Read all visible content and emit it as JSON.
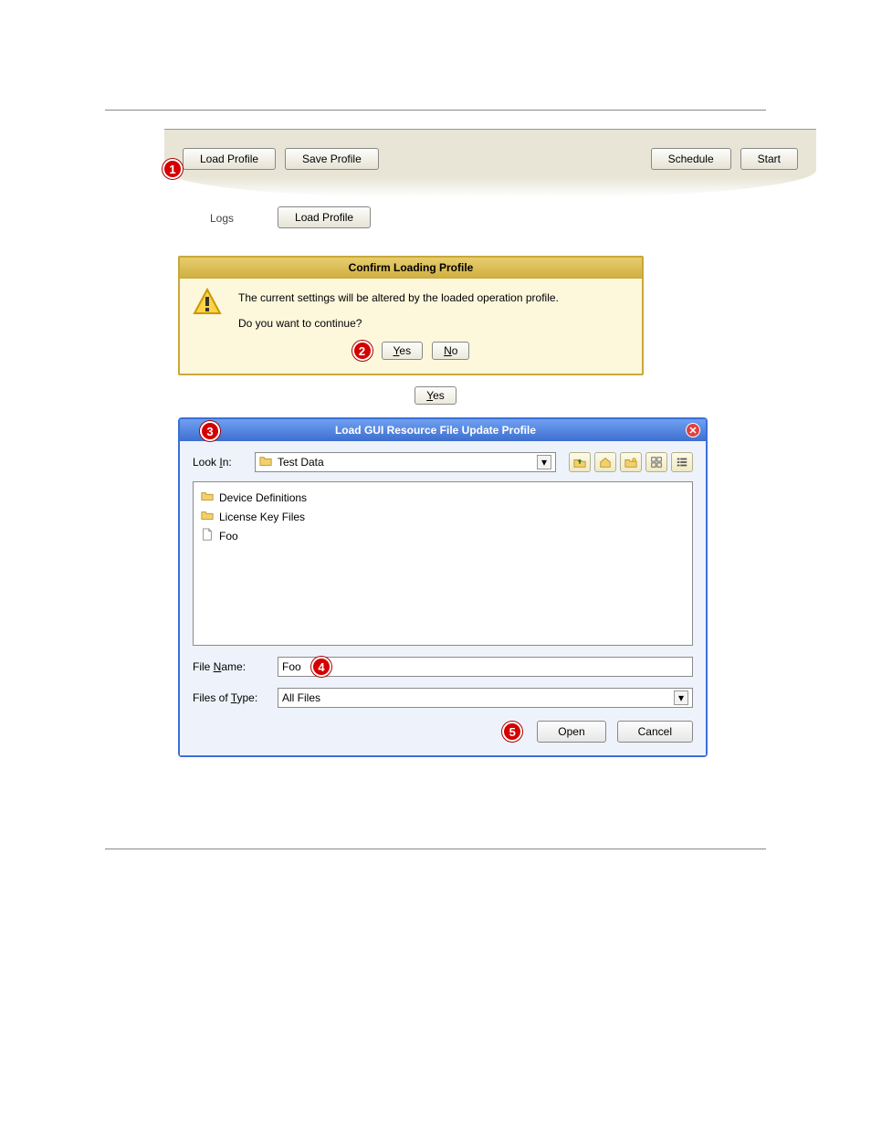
{
  "toolbar": {
    "load_profile": "Load Profile",
    "save_profile": "Save Profile",
    "schedule": "Schedule",
    "start": "Start"
  },
  "callouts": {
    "c1": "1",
    "c2": "2",
    "c3": "3",
    "c4": "4",
    "c5": "5"
  },
  "step1": {
    "logs_label": "Logs",
    "load_profile_btn": "Load Profile"
  },
  "confirm": {
    "title": "Confirm Loading Profile",
    "msg1": "The current settings will be altered by the loaded operation profile.",
    "msg2": "Do you want to continue?",
    "yes_pre": "Y",
    "yes_rest": "es",
    "no_pre": "N",
    "no_rest": "o"
  },
  "yes_standalone_pre": "Y",
  "yes_standalone_rest": "es",
  "chooser": {
    "title": "Load GUI Resource File Update Profile",
    "lookin_pre": "Look ",
    "lookin_u": "I",
    "lookin_post": "n:",
    "lookin_value": "Test Data",
    "files": [
      {
        "type": "folder",
        "name": "Device Definitions"
      },
      {
        "type": "folder",
        "name": "License Key Files"
      },
      {
        "type": "file",
        "name": "Foo"
      }
    ],
    "filename_pre": "File ",
    "filename_u": "N",
    "filename_post": "ame:",
    "filename_value": "Foo",
    "filetype_pre": "Files of ",
    "filetype_u": "T",
    "filetype_post": "ype:",
    "filetype_value": "All Files",
    "open": "Open",
    "cancel": "Cancel"
  }
}
